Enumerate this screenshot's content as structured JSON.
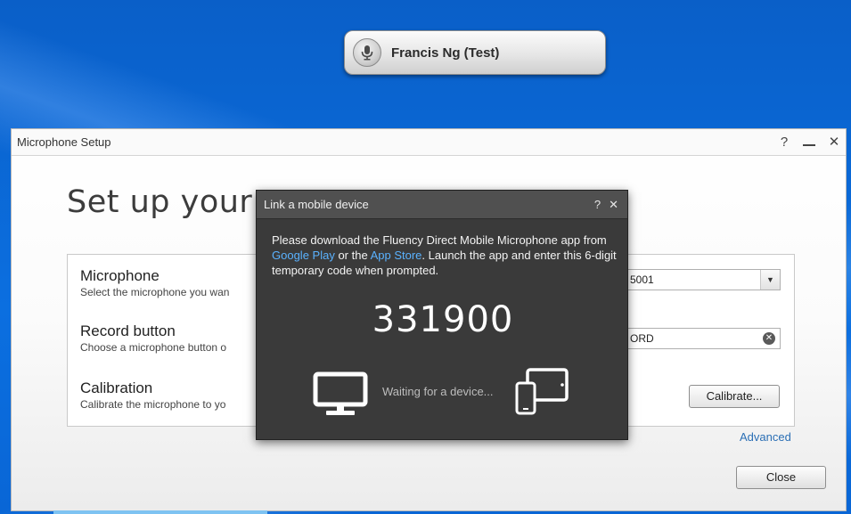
{
  "status_pill": {
    "user_name": "Francis Ng (Test)",
    "icon": "microphone-icon"
  },
  "window": {
    "title": "Microphone Setup",
    "controls": {
      "help": "?",
      "close": "✕"
    },
    "heading": "Set up your microphone",
    "heading_visible": "Set up your m",
    "rows": [
      {
        "title": "Microphone",
        "desc": "Select the microphone you wan"
      },
      {
        "title": "Record button",
        "desc": "Choose a microphone button o"
      },
      {
        "title": "Calibration",
        "desc": "Calibrate the microphone to yo"
      }
    ],
    "microphone_select": {
      "value": "5001"
    },
    "record_field": {
      "value": "ORD"
    },
    "calibrate_label": "Calibrate...",
    "advanced_label": "Advanced",
    "close_label": "Close"
  },
  "modal": {
    "title": "Link a mobile device",
    "controls": {
      "help": "?",
      "close": "✕"
    },
    "text_before": "Please download the Fluency Direct Mobile Microphone app from ",
    "link_google": "Google Play",
    "text_mid": " or the ",
    "link_app_store": "App Store",
    "text_after": ".  Launch the app and enter this 6-digit temporary code when prompted.",
    "code": "331900",
    "waiting": "Waiting for a device..."
  },
  "colors": {
    "desktop": "#0b6fe0",
    "modal_bg": "#3a3a3a",
    "link": "#5ab2ff",
    "advanced_link": "#2b6fb5"
  }
}
